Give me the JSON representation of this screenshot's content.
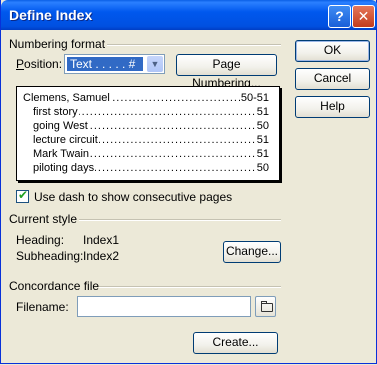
{
  "window": {
    "title": "Define Index"
  },
  "numbering": {
    "group_label": "Numbering format",
    "position_label": "Position:",
    "position_value": "Text . . . . . #",
    "page_numbering_button": "Page Numbering..."
  },
  "preview": {
    "entries": [
      {
        "text": "Clemens, Samuel",
        "page": "50-51",
        "level": 0
      },
      {
        "text": "first story",
        "page": "51",
        "level": 1
      },
      {
        "text": "going West",
        "page": "50",
        "level": 1
      },
      {
        "text": "lecture circuit",
        "page": "51",
        "level": 1
      },
      {
        "text": "Mark Twain",
        "page": "51",
        "level": 1
      },
      {
        "text": "piloting days",
        "page": "50",
        "level": 1
      }
    ]
  },
  "dash_option": {
    "label": "Use dash to show consecutive pages",
    "checked": true
  },
  "current_style": {
    "group_label": "Current style",
    "heading_label": "Heading:",
    "heading_value": "Index1",
    "subheading_label": "Subheading:",
    "subheading_value": "Index2",
    "change_button": "Change..."
  },
  "concordance": {
    "group_label": "Concordance file",
    "filename_label": "Filename:",
    "filename_value": "",
    "create_button": "Create..."
  },
  "buttons": {
    "ok": "OK",
    "cancel": "Cancel",
    "help": "Help"
  },
  "title_buttons": {
    "help_glyph": "?",
    "close_glyph": "✕"
  }
}
